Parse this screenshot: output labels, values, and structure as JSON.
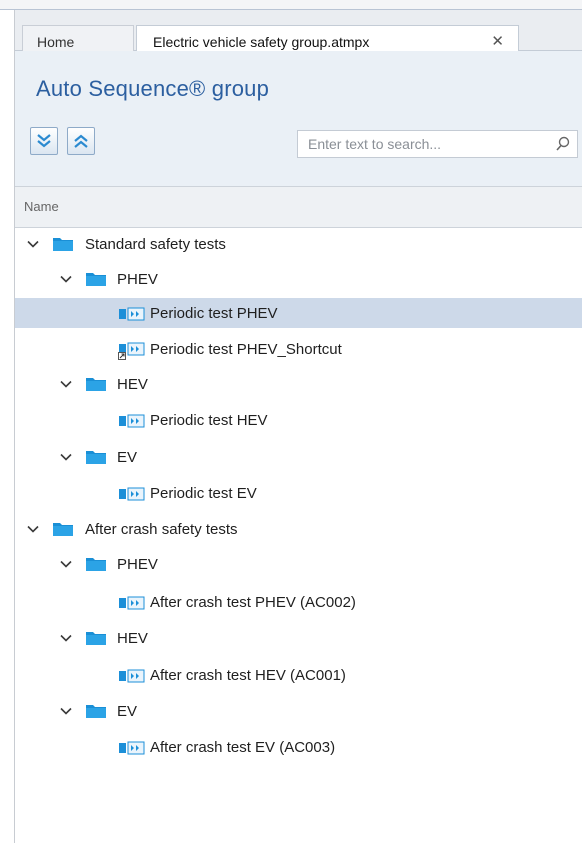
{
  "tabs": {
    "home_label": "Home",
    "active_label": "Electric vehicle safety group.atmpx",
    "close_glyph": "✕"
  },
  "panel": {
    "title": "Auto Sequence® group"
  },
  "toolbar": {
    "expand_all_icon": "double-chevron-down-icon",
    "collapse_all_icon": "double-chevron-up-icon"
  },
  "search": {
    "placeholder": "Enter text to search...",
    "value": ""
  },
  "columns": {
    "name": "Name"
  },
  "colors": {
    "title_blue": "#2c5fa0",
    "folder_blue": "#1e96db",
    "selection": "#cdd9e9"
  },
  "tree": {
    "standard": {
      "label": "Standard safety tests",
      "phev": {
        "label": "PHEV",
        "item1": "Periodic test PHEV",
        "item2": "Periodic test PHEV_Shortcut"
      },
      "hev": {
        "label": "HEV",
        "item1": "Periodic test HEV"
      },
      "ev": {
        "label": "EV",
        "item1": "Periodic test EV"
      }
    },
    "after_crash": {
      "label": "After crash safety tests",
      "phev": {
        "label": "PHEV",
        "item1": "After crash test PHEV (AC002)"
      },
      "hev": {
        "label": "HEV",
        "item1": "After crash test HEV (AC001)"
      },
      "ev": {
        "label": "EV",
        "item1": "After crash test EV (AC003)"
      }
    }
  }
}
